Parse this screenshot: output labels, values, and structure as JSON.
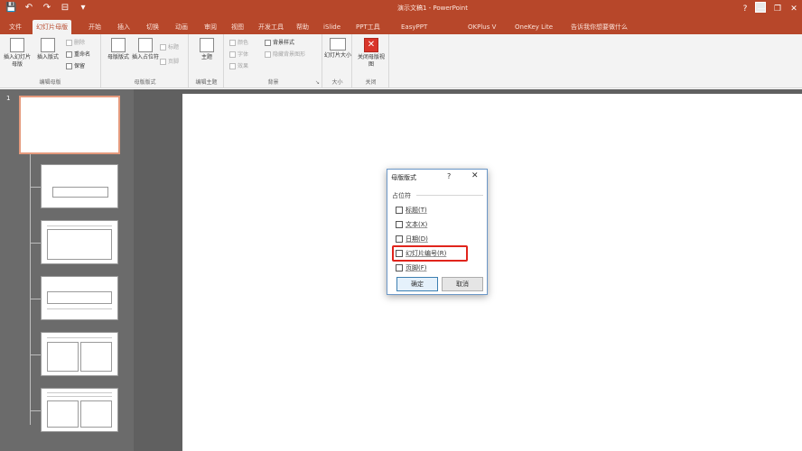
{
  "titlebar": {
    "qat": [
      "💾",
      "↶",
      "↷",
      "⊟",
      "▾"
    ],
    "doc_title": "演示文稿1 - PowerPoint",
    "controls": [
      "?",
      "—",
      "❐",
      "✕"
    ]
  },
  "tabs": [
    {
      "label": "文件",
      "active": false
    },
    {
      "label": "幻灯片母版",
      "active": true
    },
    {
      "label": "开始",
      "active": false
    },
    {
      "label": "插入",
      "active": false
    },
    {
      "label": "切换",
      "active": false
    },
    {
      "label": "动画",
      "active": false
    },
    {
      "label": "审阅",
      "active": false
    },
    {
      "label": "视图",
      "active": false
    },
    {
      "label": "开发工具",
      "active": false
    },
    {
      "label": "帮助",
      "active": false
    },
    {
      "label": "iSlide",
      "active": false
    },
    {
      "label": "PPT工具",
      "active": false
    },
    {
      "label": "EasyPPT",
      "active": false
    },
    {
      "label": "OKPlus V",
      "active": false
    },
    {
      "label": "OneKey Lite",
      "active": false
    },
    {
      "label": "告诉我你想要做什么",
      "active": false
    }
  ],
  "ribbon": {
    "edit_master": {
      "label": "编辑母版",
      "insert_master": "插入幻灯片母版",
      "insert_layout": "插入版式",
      "delete": "删除",
      "rename": "重命名",
      "preserve": "保留"
    },
    "master_layout": {
      "label": "母版版式",
      "master_layout": "母版版式",
      "insert_placeholder": "插入占位符",
      "title": "标题",
      "footer": "页脚"
    },
    "edit_theme": {
      "label": "编辑主题",
      "themes": "主题"
    },
    "background": {
      "label": "背景",
      "colors": "颜色",
      "fonts": "字体",
      "effects": "效果",
      "background_styles": "背景样式",
      "hide_background": "隐藏背景图形"
    },
    "size": {
      "label": "大小",
      "slide_size": "幻灯片大小"
    },
    "close": {
      "label": "关闭",
      "close_master": "关闭母版视图"
    }
  },
  "slides": {
    "number": "1"
  },
  "dialog": {
    "title": "母版版式",
    "help": "?",
    "close": "✕",
    "section": "占位符",
    "options": [
      {
        "label": "标题(T)",
        "checked": false
      },
      {
        "label": "文本(X)",
        "checked": false
      },
      {
        "label": "日期(D)",
        "checked": false
      },
      {
        "label": "幻灯片编号(R)",
        "checked": false,
        "highlighted": true
      },
      {
        "label": "页脚(F)",
        "checked": false
      }
    ],
    "ok": "确定",
    "cancel": "取消"
  },
  "colors": {
    "accent": "#b7472a",
    "highlight": "#e0241c",
    "selected_thumb_border": "#e59a7d"
  }
}
